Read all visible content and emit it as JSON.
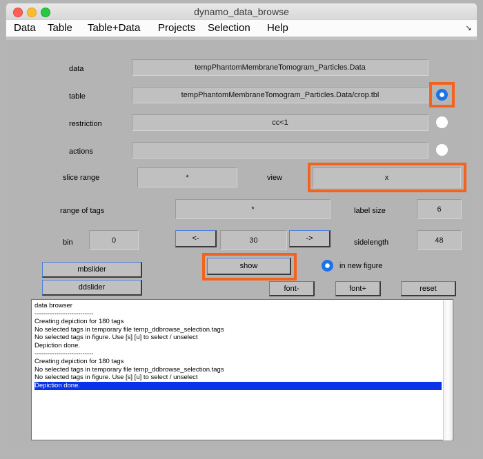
{
  "window": {
    "title": "dynamo_data_browse",
    "controls": [
      "close",
      "minimize",
      "maximize"
    ]
  },
  "menubar": {
    "items": [
      {
        "label": "Data"
      },
      {
        "label": "Table"
      },
      {
        "label": "Table+Data"
      },
      {
        "label": "Projects"
      },
      {
        "label": "Selection"
      },
      {
        "label": "Help"
      }
    ],
    "overflow_icon": "overflow-arrow-icon",
    "overflow_glyph": "↘"
  },
  "form": {
    "rows": [
      {
        "label": "data",
        "value": "tempPhantomMembraneTomogram_Particles.Data"
      },
      {
        "label": "table",
        "value": "tempPhantomMembraneTomogram_Particles.Data/crop.tbl"
      },
      {
        "label": "restriction",
        "value": "cc<1"
      },
      {
        "label": "actions",
        "value": ""
      }
    ],
    "radios": [
      {
        "name": "table-radio",
        "selected": true
      },
      {
        "name": "restriction-radio",
        "selected": false
      },
      {
        "name": "actions-radio",
        "selected": false
      }
    ],
    "slice_range": {
      "label": "slice range",
      "value": "*"
    },
    "view": {
      "label": "view",
      "value": "x"
    },
    "range_of_tags": {
      "label": "range of tags",
      "value": "*"
    },
    "label_size": {
      "label": "label size",
      "value": "6"
    },
    "bin": {
      "label": "bin",
      "value": "0"
    },
    "sidelength": {
      "label": "sidelength",
      "value": "48"
    },
    "tag_stepper": {
      "prev_label": "<-",
      "value": "30",
      "next_label": "->"
    }
  },
  "buttons": {
    "mbslider": "mbslider",
    "ddslider": "ddslider",
    "show": "show",
    "font_minus": "font-",
    "font_plus": "font+",
    "reset": "reset"
  },
  "new_figure": {
    "label": "in new figure",
    "selected": true
  },
  "log": {
    "lines": [
      {
        "text": "data browser",
        "selected": false
      },
      {
        "text": "---------------------------",
        "selected": false
      },
      {
        "text": "Creating depiction for 180 tags",
        "selected": false
      },
      {
        "text": "No selected tags in temporary file temp_ddbrowse_selection.tags",
        "selected": false
      },
      {
        "text": "No selected tags in figure. Use [s] [u] to select / unselect",
        "selected": false
      },
      {
        "text": "Depiction done.",
        "selected": false
      },
      {
        "text": "---------------------------",
        "selected": false
      },
      {
        "text": "Creating depiction for 180 tags",
        "selected": false
      },
      {
        "text": "No selected tags in temporary file temp_ddbrowse_selection.tags",
        "selected": false
      },
      {
        "text": "No selected tags in figure. Use [s] [u] to select / unselect",
        "selected": false
      },
      {
        "text": "Depiction done.",
        "selected": true
      }
    ]
  },
  "colors": {
    "highlight": "#f4631e",
    "radio_on": "#1a73e8",
    "selection": "#0a32e8",
    "panel_bg": "#b4b4b4",
    "widget_bg": "#c0c0c0"
  }
}
